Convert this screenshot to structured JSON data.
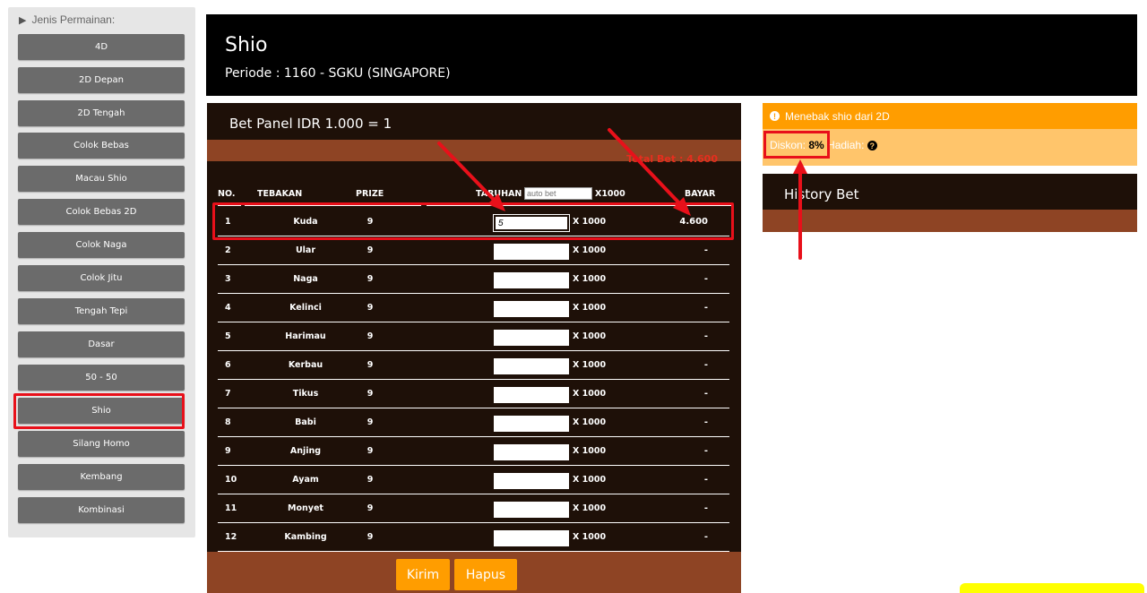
{
  "sidebar": {
    "title": "Jenis Permainan:",
    "items": [
      {
        "label": "4D"
      },
      {
        "label": "2D Depan"
      },
      {
        "label": "2D Tengah"
      },
      {
        "label": "Colok Bebas"
      },
      {
        "label": "Macau Shio"
      },
      {
        "label": "Colok Bebas 2D"
      },
      {
        "label": "Colok Naga"
      },
      {
        "label": "Colok Jitu"
      },
      {
        "label": "Tengah Tepi"
      },
      {
        "label": "Dasar"
      },
      {
        "label": "50 - 50"
      },
      {
        "label": "Shio"
      },
      {
        "label": "Silang Homo"
      },
      {
        "label": "Kembang"
      },
      {
        "label": "Kombinasi"
      }
    ]
  },
  "header": {
    "title": "Shio",
    "periode": "Periode : 1160 - SGKU (SINGAPORE)"
  },
  "panel": {
    "title": "Bet Panel IDR 1.000 = 1",
    "total_bet": "Total Bet : 4.600",
    "columns": {
      "no": "NO.",
      "tebakan": "TEBAKAN",
      "prize": "PRIZE",
      "taruhan": "TARUHAN",
      "x1000": "X1000",
      "bayar": "BAYAR"
    },
    "auto_bet_placeholder": "auto bet",
    "multiplier_label": "X 1000",
    "rows": [
      {
        "no": "1",
        "tebakan": "Kuda",
        "prize": "9",
        "taruhan": "5",
        "bayar": "4.600"
      },
      {
        "no": "2",
        "tebakan": "Ular",
        "prize": "9",
        "taruhan": "",
        "bayar": "-"
      },
      {
        "no": "3",
        "tebakan": "Naga",
        "prize": "9",
        "taruhan": "",
        "bayar": "-"
      },
      {
        "no": "4",
        "tebakan": "Kelinci",
        "prize": "9",
        "taruhan": "",
        "bayar": "-"
      },
      {
        "no": "5",
        "tebakan": "Harimau",
        "prize": "9",
        "taruhan": "",
        "bayar": "-"
      },
      {
        "no": "6",
        "tebakan": "Kerbau",
        "prize": "9",
        "taruhan": "",
        "bayar": "-"
      },
      {
        "no": "7",
        "tebakan": "Tikus",
        "prize": "9",
        "taruhan": "",
        "bayar": "-"
      },
      {
        "no": "8",
        "tebakan": "Babi",
        "prize": "9",
        "taruhan": "",
        "bayar": "-"
      },
      {
        "no": "9",
        "tebakan": "Anjing",
        "prize": "9",
        "taruhan": "",
        "bayar": "-"
      },
      {
        "no": "10",
        "tebakan": "Ayam",
        "prize": "9",
        "taruhan": "",
        "bayar": "-"
      },
      {
        "no": "11",
        "tebakan": "Monyet",
        "prize": "9",
        "taruhan": "",
        "bayar": "-"
      },
      {
        "no": "12",
        "tebakan": "Kambing",
        "prize": "9",
        "taruhan": "",
        "bayar": "-"
      }
    ],
    "kirim_label": "Kirim",
    "hapus_label": "Hapus"
  },
  "info": {
    "heading": "Menebak shio dari 2D",
    "diskon_label": "Diskon:",
    "diskon_value": "8%",
    "hadiah_label": "Hadiah:"
  },
  "history": {
    "title": "History Bet"
  },
  "colors": {
    "accent_orange": "#ff9d00",
    "panel_dark": "#1e1008",
    "panel_brown": "#8e4424",
    "annotation_red": "#e8101a"
  }
}
